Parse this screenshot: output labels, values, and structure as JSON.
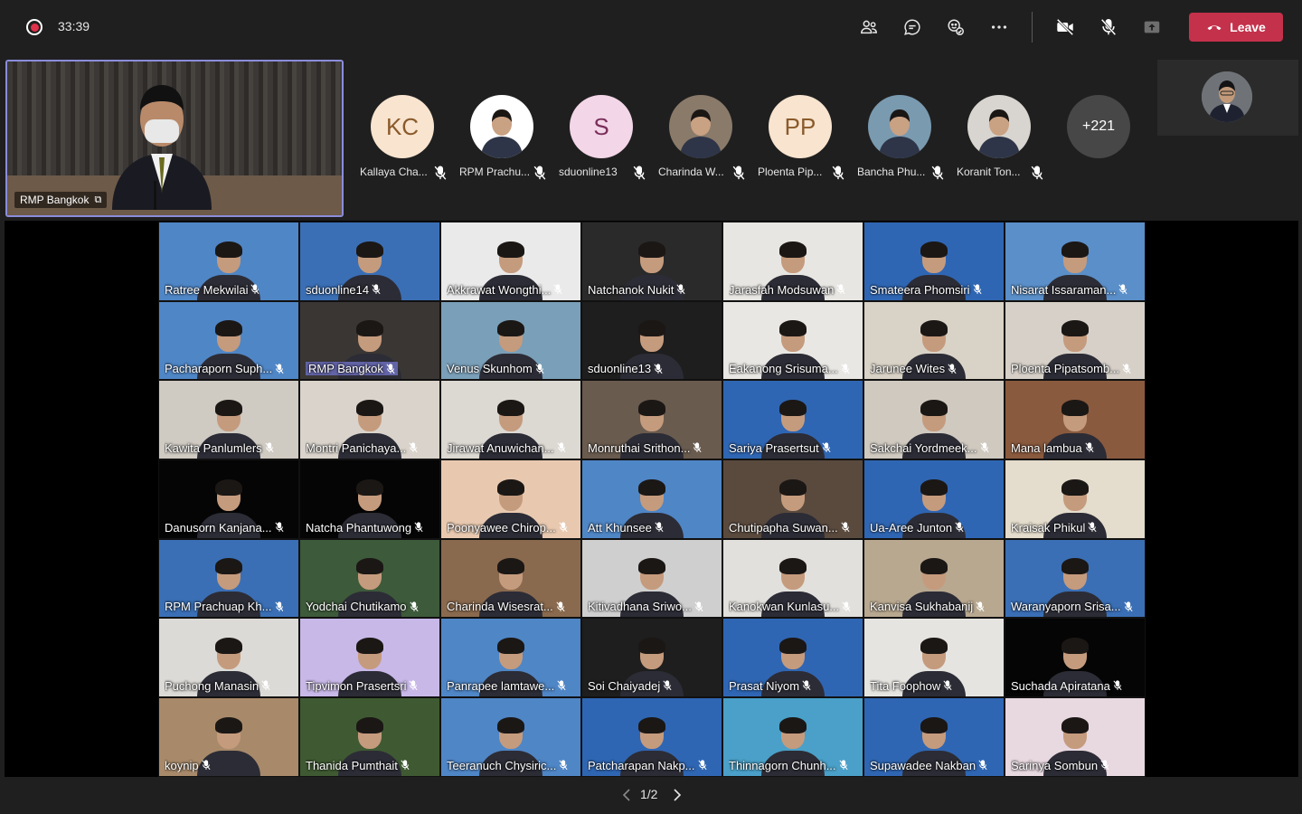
{
  "meeting": {
    "timer": "33:39",
    "leave_label": "Leave"
  },
  "toolbar": {
    "icons": [
      "participants-icon",
      "chat-icon",
      "reactions-icon",
      "more-icon",
      "camera-off-icon",
      "mic-off-icon",
      "share-icon"
    ]
  },
  "spotlight": {
    "name": "RMP Bangkok"
  },
  "avatars": [
    {
      "initials": "KC",
      "name": "Kallaya Cha...",
      "bg": "#f8e4cf",
      "fg": "#8a5a2b"
    },
    {
      "initials": "",
      "name": "RPM Prachu...",
      "bg": "#ffffff",
      "fg": "#333"
    },
    {
      "initials": "S",
      "name": "sduonline13",
      "bg": "#f3d6e8",
      "fg": "#7a2f5a"
    },
    {
      "initials": "",
      "name": "Charinda W...",
      "bg": "#8a7a6a",
      "fg": "#fff"
    },
    {
      "initials": "PP",
      "name": "Ploenta Pip...",
      "bg": "#f8e4cf",
      "fg": "#8a5a2b"
    },
    {
      "initials": "",
      "name": "Bancha Phu...",
      "bg": "#7a9ab0",
      "fg": "#fff"
    },
    {
      "initials": "",
      "name": "Koranit Ton...",
      "bg": "#d8d4cf",
      "fg": "#333"
    }
  ],
  "overflow_count": "+221",
  "tiles": [
    {
      "name": "Ratree Mekwilai",
      "bg": "#4f86c6"
    },
    {
      "name": "sduonline14",
      "bg": "#3a6fb5"
    },
    {
      "name": "Akkrawat Wongthi...",
      "bg": "#eaeaea"
    },
    {
      "name": "Natchanok Nukit",
      "bg": "#2a2a2a"
    },
    {
      "name": "Jarasfah Modsuwan",
      "bg": "#e8e6e2"
    },
    {
      "name": "Smateera Phomsiri",
      "bg": "#2f66b3"
    },
    {
      "name": "Nisarat Issaraman...",
      "bg": "#5a8fc9"
    },
    {
      "name": "Pacharaporn Suph...",
      "bg": "#4f86c6"
    },
    {
      "name": "RMP Bangkok",
      "bg": "#3a3634",
      "hl": true
    },
    {
      "name": "Venus Skunhom",
      "bg": "#7a9fb8"
    },
    {
      "name": "sduonline13",
      "bg": "#1e1e1e"
    },
    {
      "name": "Eakanong Srisuma...",
      "bg": "#e9e7e3"
    },
    {
      "name": "Jarunee Wites",
      "bg": "#d9d2c6"
    },
    {
      "name": "Ploenta Pipatsomb...",
      "bg": "#d6d0c8"
    },
    {
      "name": "Kawita Panlumlers",
      "bg": "#cfcac2"
    },
    {
      "name": "Montri Panichaya...",
      "bg": "#d9d3cb"
    },
    {
      "name": "Jirawat Anuwichan...",
      "bg": "#dcd8d2"
    },
    {
      "name": "Monruthai Srithon...",
      "bg": "#6a5b4f"
    },
    {
      "name": "Sariya Prasertsut",
      "bg": "#2f66b3"
    },
    {
      "name": "Sakchai Yordmeek...",
      "bg": "#cfc9c0"
    },
    {
      "name": "Mana lambua",
      "bg": "#8a5a3e"
    },
    {
      "name": "Danusorn Kanjana...",
      "bg": "#050505"
    },
    {
      "name": "Natcha Phantuwong",
      "bg": "#050505"
    },
    {
      "name": "Poonyawee Chirop...",
      "bg": "#e8c9b0"
    },
    {
      "name": "Att Khunsee",
      "bg": "#4f86c6"
    },
    {
      "name": "Chutipapha Suwan...",
      "bg": "#5a4a3e"
    },
    {
      "name": "Ua-Aree Junton",
      "bg": "#2f66b3"
    },
    {
      "name": "Kraisak Phikul",
      "bg": "#e4dccc"
    },
    {
      "name": "RPM  Prachuap Kh...",
      "bg": "#3a6fb5"
    },
    {
      "name": "Yodchai Chutikamo",
      "bg": "#3d5a3a"
    },
    {
      "name": "Charinda Wisesrat...",
      "bg": "#8a6a4e"
    },
    {
      "name": "Kitivadhana Sriwo...",
      "bg": "#cfcfcf"
    },
    {
      "name": "Kanokwan Kunlasu...",
      "bg": "#e2e0dc"
    },
    {
      "name": "Kanvisa Sukhabanij",
      "bg": "#b8a890"
    },
    {
      "name": "Waranyaporn Srisa...",
      "bg": "#3a6fb5"
    },
    {
      "name": "Puchong Manasin",
      "bg": "#dcdad6"
    },
    {
      "name": "Tipvimon Prasertsri",
      "bg": "#c8b8e8"
    },
    {
      "name": "Panrapee lamtawe...",
      "bg": "#4f86c6"
    },
    {
      "name": "Soi Chaiyadej",
      "bg": "#1e1e1e"
    },
    {
      "name": "Prasat Niyom",
      "bg": "#2f66b3"
    },
    {
      "name": "Tita Foophow",
      "bg": "#e6e4e0"
    },
    {
      "name": "Suchada Apiratana",
      "bg": "#050505"
    },
    {
      "name": "koynip",
      "bg": "#a88a6a"
    },
    {
      "name": "Thanida Pumthait",
      "bg": "#3f5a32"
    },
    {
      "name": "Teeranuch Chysiric...",
      "bg": "#4f86c6"
    },
    {
      "name": "Patcharapan Nakp...",
      "bg": "#2f66b3"
    },
    {
      "name": "Thinnagorn Chunh...",
      "bg": "#4aa0c8"
    },
    {
      "name": "Supawadee Nakban",
      "bg": "#2f66b3"
    },
    {
      "name": "Sarinya Sombun",
      "bg": "#e8d8e0"
    }
  ],
  "pager": {
    "text": "1/2"
  }
}
